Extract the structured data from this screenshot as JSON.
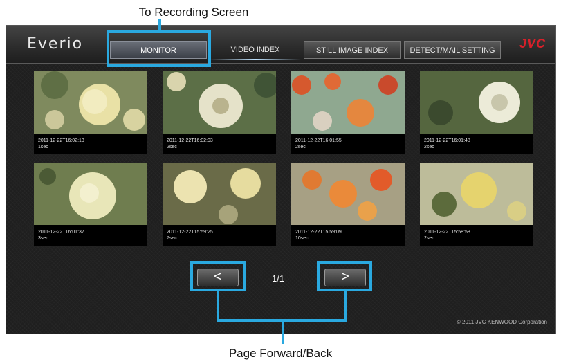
{
  "callouts": {
    "top": "To Recording Screen",
    "bottom": "Page Forward/Back"
  },
  "app": {
    "logo": "Everio",
    "brand": "JVC"
  },
  "tabs": [
    {
      "label": "MONITOR",
      "active": true
    },
    {
      "label": "VIDEO INDEX",
      "active": false
    },
    {
      "label": "STILL IMAGE INDEX",
      "active": false
    },
    {
      "label": "DETECT/MAIL SETTING",
      "active": false
    }
  ],
  "videos": [
    {
      "timestamp": "2011-12-22T16:02:13",
      "duration": "1sec"
    },
    {
      "timestamp": "2011-12-22T16:02:03",
      "duration": "2sec"
    },
    {
      "timestamp": "2011-12-22T16:01:55",
      "duration": "2sec"
    },
    {
      "timestamp": "2011-12-22T16:01:48",
      "duration": "2sec"
    },
    {
      "timestamp": "2011-12-22T16:01:37",
      "duration": "3sec"
    },
    {
      "timestamp": "2011-12-22T15:59:25",
      "duration": "7sec"
    },
    {
      "timestamp": "2011-12-22T15:59:09",
      "duration": "10sec"
    },
    {
      "timestamp": "2011-12-22T15:58:58",
      "duration": "2sec"
    }
  ],
  "pager": {
    "prev": "<",
    "next": ">",
    "page": "1/1"
  },
  "footer": {
    "copyright": "© 2011 JVC KENWOOD Corporation"
  },
  "colors": {
    "highlight": "#2aa9e0",
    "brand": "#d8202a"
  }
}
